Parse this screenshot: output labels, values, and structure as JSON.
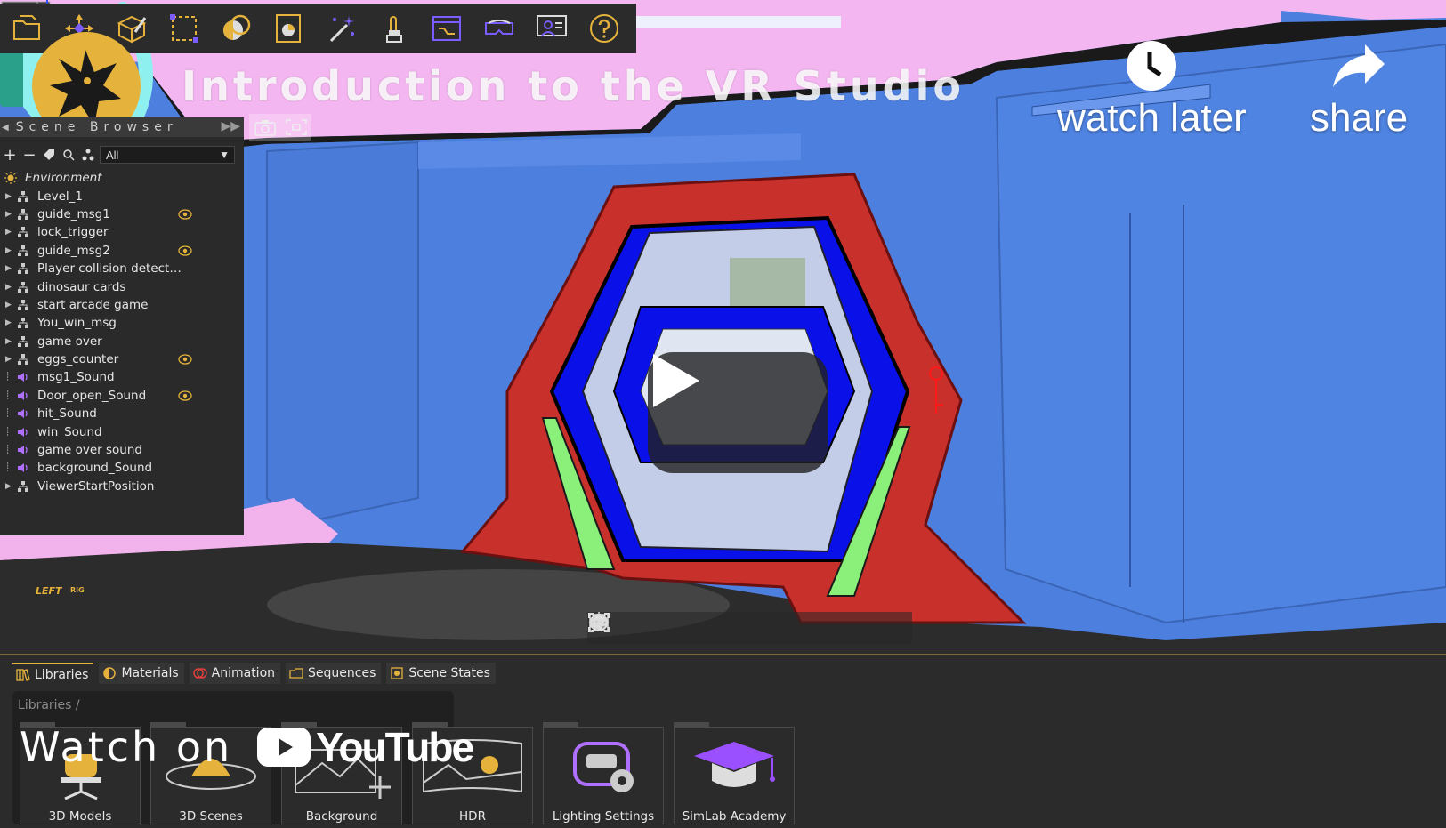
{
  "video": {
    "title": "Introduction to the VR Studio",
    "watch_later_label": "watch later",
    "share_label": "share",
    "watch_on_label": "Watch on",
    "youtube_wordmark": "YouTube"
  },
  "toolbar": {
    "icons": [
      "open-file-icon",
      "transform-icon",
      "edit-icon",
      "select-box-icon",
      "materials-icon",
      "animation-icon",
      "magic-wand-icon",
      "interaction-icon",
      "sequence-icon",
      "vr-headset-icon",
      "presenter-icon",
      "help-icon"
    ]
  },
  "scene_browser": {
    "title": "Scene Browser",
    "filter_value": "All",
    "items": [
      {
        "label": "Environment",
        "type": "environment",
        "expandable": false,
        "eye": false
      },
      {
        "label": "Level_1",
        "type": "group",
        "expandable": true,
        "eye": false
      },
      {
        "label": "guide_msg1",
        "type": "group",
        "expandable": true,
        "eye": true
      },
      {
        "label": "lock_trigger",
        "type": "group",
        "expandable": true,
        "eye": false
      },
      {
        "label": "guide_msg2",
        "type": "group",
        "expandable": true,
        "eye": true
      },
      {
        "label": "Player collision detect…",
        "type": "group",
        "expandable": true,
        "eye": false
      },
      {
        "label": "dinosaur cards",
        "type": "group",
        "expandable": true,
        "eye": false
      },
      {
        "label": "start arcade game",
        "type": "group",
        "expandable": true,
        "eye": false
      },
      {
        "label": "You_win_msg",
        "type": "group",
        "expandable": true,
        "eye": false
      },
      {
        "label": "game over",
        "type": "group",
        "expandable": true,
        "eye": false
      },
      {
        "label": "eggs_counter",
        "type": "group",
        "expandable": true,
        "eye": true
      },
      {
        "label": "msg1_Sound",
        "type": "sound",
        "expandable": false,
        "eye": false
      },
      {
        "label": "Door_open_Sound",
        "type": "sound",
        "expandable": false,
        "eye": true
      },
      {
        "label": "hit_Sound",
        "type": "sound",
        "expandable": false,
        "eye": false
      },
      {
        "label": "win_Sound",
        "type": "sound",
        "expandable": false,
        "eye": false
      },
      {
        "label": "game over sound",
        "type": "sound",
        "expandable": false,
        "eye": false
      },
      {
        "label": "background_Sound",
        "type": "sound",
        "expandable": false,
        "eye": false
      },
      {
        "label": "ViewerStartPosition",
        "type": "group",
        "expandable": true,
        "eye": false
      }
    ]
  },
  "nav_cube": {
    "face_label": "LEFT",
    "side_label": "RIG"
  },
  "bottom_panel": {
    "tabs": [
      "Libraries",
      "Materials",
      "Animation",
      "Sequences",
      "Scene States"
    ],
    "active_tab": "Libraries",
    "breadcrumb": "Libraries  /",
    "libraries": [
      "3D Models",
      "3D Scenes",
      "Background",
      "HDR",
      "Lighting Settings",
      "SimLab Academy"
    ]
  },
  "colors": {
    "wall_blue": "#4d7fde",
    "ceiling_pink": "#f4b6f0",
    "door_red": "#c8302b",
    "door_blue": "#0a10e8",
    "accent_green": "#8af07a",
    "panel_bg": "#2a2a2a",
    "accent_gold": "#e5b33c"
  }
}
